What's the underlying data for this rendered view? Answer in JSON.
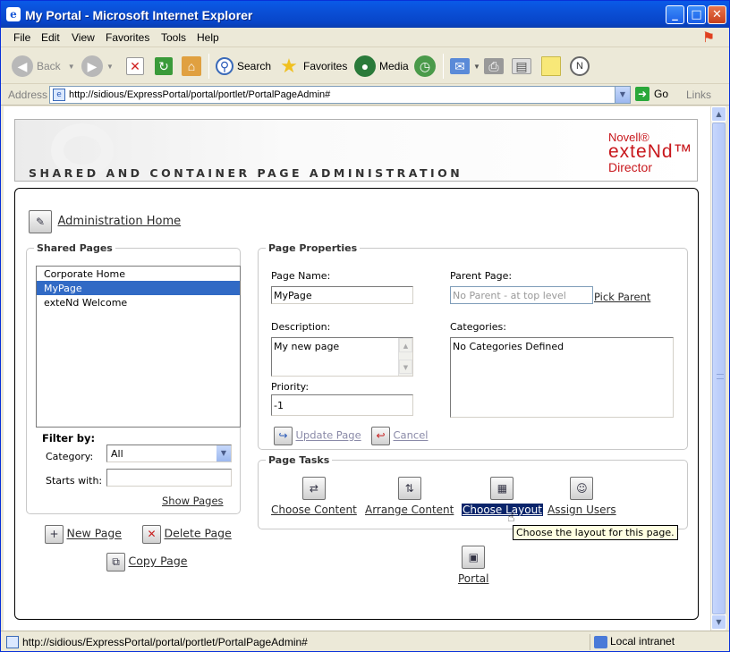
{
  "window": {
    "title": "My Portal - Microsoft Internet Explorer",
    "controls": {
      "minimize": "_",
      "maximize": "□",
      "close": "✕"
    }
  },
  "menu": [
    "File",
    "Edit",
    "View",
    "Favorites",
    "Tools",
    "Help"
  ],
  "toolbar": {
    "back": "Back",
    "search": "Search",
    "favorites": "Favorites",
    "media": "Media"
  },
  "address": {
    "label": "Address",
    "url": "http://sidious/ExpressPortal/portal/portlet/PortalPageAdmin#",
    "go": "Go",
    "links": "Links"
  },
  "banner": {
    "title": "SHARED AND CONTAINER PAGE ADMINISTRATION",
    "brand_line1": "Novell®",
    "brand_line2": "exteNd™",
    "brand_line3": "Director",
    "accent": "#c8171c"
  },
  "admin_home": "Administration Home",
  "shared_pages": {
    "legend": "Shared Pages",
    "items": [
      "Corporate Home",
      "MyPage",
      "exteNd Welcome"
    ],
    "selected_index": 1,
    "filter_label": "Filter by:",
    "category_label": "Category:",
    "category_value": "All",
    "starts_with_label": "Starts with:",
    "starts_with_value": "",
    "show_pages": "Show Pages"
  },
  "page_actions": {
    "new_page": "New Page",
    "delete_page": "Delete Page",
    "copy_page": "Copy Page"
  },
  "page_properties": {
    "legend": "Page Properties",
    "name_label": "Page Name:",
    "name_value": "MyPage",
    "parent_label": "Parent Page:",
    "parent_placeholder": "No Parent - at top level",
    "pick_parent": "Pick Parent",
    "description_label": "Description:",
    "description_value": "My new page",
    "categories_label": "Categories:",
    "categories_value": "No Categories Defined",
    "priority_label": "Priority:",
    "priority_value": "-1",
    "update_page": "Update Page",
    "cancel": "Cancel"
  },
  "page_tasks": {
    "legend": "Page Tasks",
    "choose_content": "Choose Content",
    "arrange_content": "Arrange Content",
    "choose_layout": "Choose Layout",
    "assign_users": "Assign Users",
    "tooltip": "Choose the layout for this page.",
    "portal": "Portal"
  },
  "status": {
    "url": "http://sidious/ExpressPortal/portal/portlet/PortalPageAdmin#",
    "zone": "Local intranet"
  },
  "colors": {
    "title_bar": "#0a4fd6",
    "selection": "#316ac5",
    "tooltip_bg": "#ffffe1"
  }
}
